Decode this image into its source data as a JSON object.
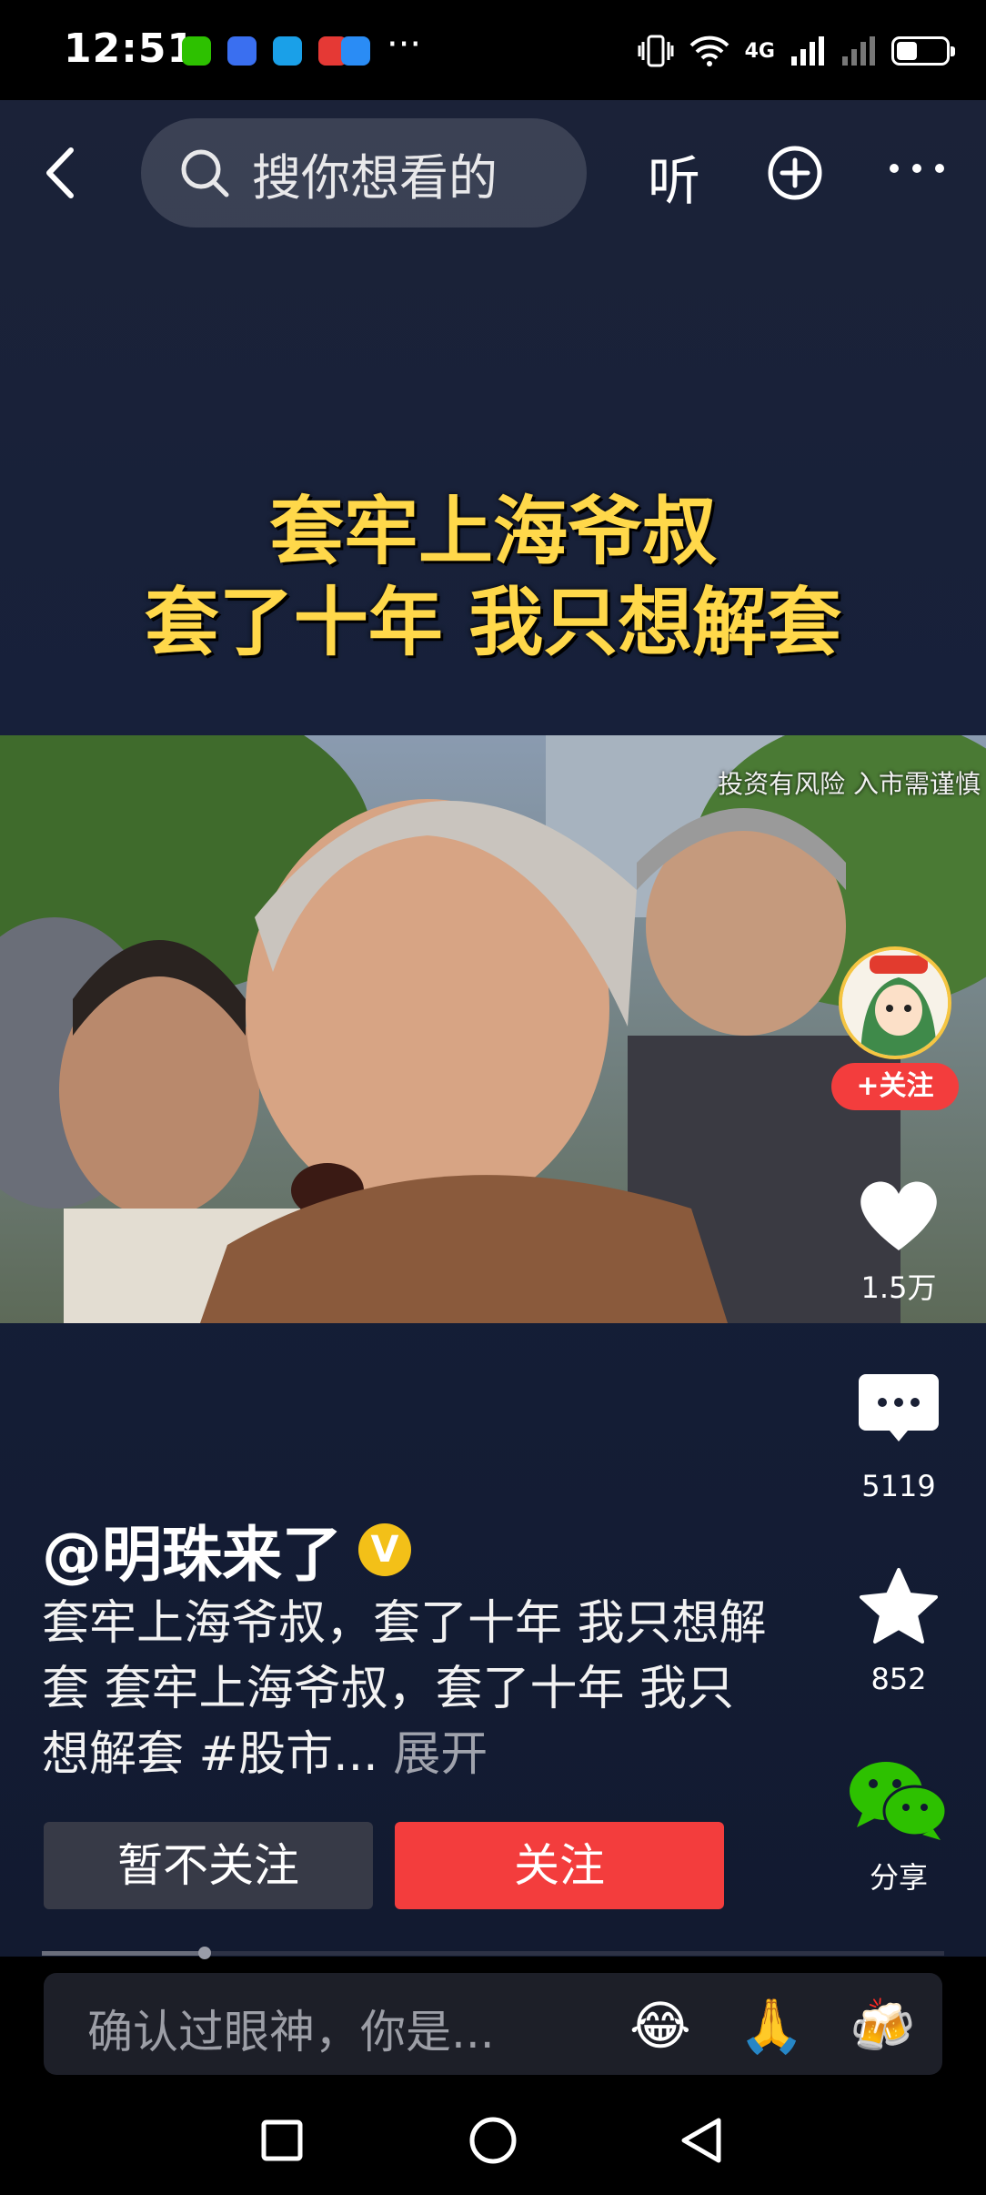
{
  "status_bar": {
    "time": "12:51",
    "more": "···",
    "network": "4G"
  },
  "top_nav": {
    "search_placeholder": "搜你想看的",
    "listen_label": "听"
  },
  "video": {
    "headline_line1": "套牢上海爷叔",
    "headline_line2": "套了十年 我只想解套",
    "risk_notice": "投资有风险 入市需谨慎"
  },
  "right_rail": {
    "follow_badge": "+关注",
    "likes": "1.5万",
    "comments": "5119",
    "favorites": "852",
    "share": "分享"
  },
  "author": {
    "name": "@明珠来了",
    "verified": "V"
  },
  "description": {
    "text": "套牢上海爷叔，套了十年  我只想解套 套牢上海爷叔，套了十年  我只想解套   #股市...",
    "expand": "展开"
  },
  "actions": {
    "no_follow": "暂不关注",
    "follow": "关注"
  },
  "playback": {
    "progress": 0.18
  },
  "comment_bar": {
    "placeholder": "确认过眼神，你是...",
    "emojis": [
      "😂",
      "🙏",
      "🍻"
    ]
  }
}
